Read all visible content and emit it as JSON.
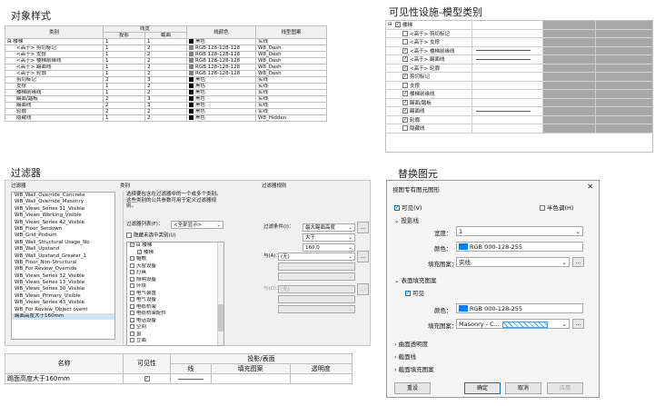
{
  "sections": {
    "object_style": "对象样式",
    "visibility": "可见性设施-模型类别",
    "filter": "过滤器",
    "replace": "替换图元"
  },
  "object_style_table": {
    "headers": {
      "category": "类别",
      "line_width": "线宽",
      "projection": "投影",
      "cut": "截面",
      "line_color": "线颜色",
      "line_pattern": "线型图案"
    },
    "rows": [
      {
        "name": "⊟ 楼梯",
        "proj": "1",
        "cut": "1",
        "color": "黑色",
        "swatch": "#000000",
        "pattern": "实线"
      },
      {
        "name": "<高于> 剪切标记",
        "proj": "1",
        "cut": "2",
        "color": "RGB 128-128-128",
        "swatch": "#808080",
        "pattern": "W8_Dash"
      },
      {
        "name": "<高于> 支撑",
        "proj": "1",
        "cut": "2",
        "color": "RGB 128-128-128",
        "swatch": "#808080",
        "pattern": "W8_Dash"
      },
      {
        "name": "<高于> 楼梯前缘线",
        "proj": "1",
        "cut": "2",
        "color": "RGB 128-128-128",
        "swatch": "#808080",
        "pattern": "W8_Dash"
      },
      {
        "name": "<高于> 踢面线",
        "proj": "1",
        "cut": "2",
        "color": "RGB 128-128-128",
        "swatch": "#808080",
        "pattern": "W8_Dash"
      },
      {
        "name": "<高于> 轮廓",
        "proj": "1",
        "cut": "2",
        "color": "RGB 128-128-128",
        "swatch": "#808080",
        "pattern": "W8_Dash"
      },
      {
        "name": "剪切标记",
        "proj": "2",
        "cut": "3",
        "color": "黑色",
        "swatch": "#000000",
        "pattern": "实线"
      },
      {
        "name": "支撑",
        "proj": "1",
        "cut": "2",
        "color": "黑色",
        "swatch": "#000000",
        "pattern": "实线"
      },
      {
        "name": "楼梯前缘线",
        "proj": "1",
        "cut": "2",
        "color": "黑色",
        "swatch": "#000000",
        "pattern": "实线"
      },
      {
        "name": "踢面/踏板",
        "proj": "2",
        "cut": "3",
        "color": "黑色",
        "swatch": "#000000",
        "pattern": "实线"
      },
      {
        "name": "踢面线",
        "proj": "2",
        "cut": "3",
        "color": "黑色",
        "swatch": "#000000",
        "pattern": "实线"
      },
      {
        "name": "轮廓",
        "proj": "2",
        "cut": "2",
        "color": "黑色",
        "swatch": "#000000",
        "pattern": "实线"
      },
      {
        "name": "隐藏线",
        "proj": "1",
        "cut": "2",
        "color": "黑色",
        "swatch": "#000000",
        "pattern": "W8_Hidden"
      }
    ]
  },
  "visibility_list": [
    {
      "label": "楼梯",
      "checked": true,
      "indent": 0,
      "expander": "⊟",
      "line": false
    },
    {
      "label": "<高于> 剪切标记",
      "checked": false,
      "indent": 1,
      "line": false
    },
    {
      "label": "<高于> 支撑",
      "checked": false,
      "indent": 1,
      "line": false
    },
    {
      "label": "<高于> 楼梯前缘线",
      "checked": true,
      "indent": 1,
      "line": true
    },
    {
      "label": "<高于> 踢面线",
      "checked": true,
      "indent": 1,
      "line": true
    },
    {
      "label": "<高于> 轮廓",
      "checked": true,
      "indent": 1,
      "line": false
    },
    {
      "label": "剪切标记",
      "checked": true,
      "indent": 1,
      "line": false
    },
    {
      "label": "支撑",
      "checked": false,
      "indent": 1,
      "line": false
    },
    {
      "label": "楼梯前缘线",
      "checked": true,
      "indent": 1,
      "line": false
    },
    {
      "label": "踢面/踏板",
      "checked": true,
      "indent": 1,
      "line": false
    },
    {
      "label": "踢面线",
      "checked": true,
      "indent": 1,
      "line": true
    },
    {
      "label": "轮廓",
      "checked": true,
      "indent": 1,
      "line": false
    },
    {
      "label": "隐藏线",
      "checked": false,
      "indent": 1,
      "line": false
    }
  ],
  "filter_dialog": {
    "filters_label": "过滤器",
    "category_label": "类别",
    "rules_label": "过滤器规则",
    "filters": [
      "WB_Wall_Override_Concrete",
      "WB_Wall_Override_Masonry",
      "WB_Views_Series 31_Visible",
      "WB_Views_Working_Visible",
      "WB_Views_Series 42_Visible",
      "WB_Floor_Setdown",
      "WB_Grid_Podium",
      "WB_Wall_Structural Usage_No",
      "WB_Wall_Upstand",
      "WB_Wall_Upstand_Greater_1",
      "WB_Floor_Non-Structural",
      "WB_For Review_Override",
      "WB_Views_Series 32_Visible",
      "WB_Views_Series 13_Visible",
      "WB_Views_Series 30_Visible",
      "WB_Views_Primary_Visible",
      "WB_Views_Series 43_Visible",
      "WB_For Review_Object overri",
      "踢面高度大于160mm"
    ],
    "category_desc": "选择要包含在过滤器中的一个或多个类别。这些类别的公共参数可用于定义过滤器规则。",
    "filter_list_label": "过滤器列表(F)：",
    "filter_list_value": "<全部显示>",
    "hide_unchecked": "隐藏未选中类别(U)",
    "categories": [
      {
        "label": "⊟ 楼梯",
        "checked": true,
        "indent": 0
      },
      {
        "label": "楼梯",
        "checked": true,
        "indent": 1
      },
      {
        "label": "帽檐",
        "checked": false,
        "indent": 0
      },
      {
        "label": "天窗设备",
        "checked": false,
        "indent": 0
      },
      {
        "label": "灯具",
        "checked": false,
        "indent": 0
      },
      {
        "label": "照明设备",
        "checked": false,
        "indent": 0
      },
      {
        "label": "环境",
        "checked": false,
        "indent": 0
      },
      {
        "label": "电气装置",
        "checked": false,
        "indent": 0
      },
      {
        "label": "电气设备",
        "checked": false,
        "indent": 0
      },
      {
        "label": "电缆桥架",
        "checked": false,
        "indent": 0
      },
      {
        "label": "电缆桥架配件",
        "checked": false,
        "indent": 0
      },
      {
        "label": "电话设备",
        "checked": false,
        "indent": 0
      },
      {
        "label": "空间",
        "checked": false,
        "indent": 0
      },
      {
        "label": "窗",
        "checked": false,
        "indent": 0
      },
      {
        "label": "立面",
        "checked": false,
        "indent": 0
      }
    ],
    "condition_label": "过滤条件(I)：",
    "condition_value": "最大踢面高度",
    "operator": "大于",
    "value": "160.0",
    "and_label": "与(A)：",
    "and_value": "(无)",
    "and2_label": "与(D)：",
    "and2_value": "(无)"
  },
  "bottom_table": {
    "name_header": "名称",
    "visible_header": "可见性",
    "proj_header": "投影/表面",
    "line_header": "线",
    "fill_header": "填充图案",
    "transparency_header": "透明度",
    "row_name": "踢面高度大于160mm"
  },
  "replace_dialog": {
    "title": "视图专有图元图形",
    "close": "✕",
    "visible": "可见(V)",
    "halftone": "半色调(H)",
    "projection_section": "投影线",
    "width_label": "宽度：",
    "width_value": "1",
    "color_label": "颜色：",
    "color_value": "RGB 000-128-255",
    "pattern_label": "填充图案：",
    "pattern_value": "实线",
    "surface_section": "表面填充图案",
    "surface_visible": "可见",
    "surface_color_value": "RGB 000-128-255",
    "surface_pattern_value": "Masonry - C...",
    "surface_transparency": "曲面透明度",
    "cut_lines": "截面线",
    "cut_pattern": "截面填充图案",
    "reset": "重设",
    "ok": "确定",
    "cancel": "取消",
    "apply": "应用",
    "accent": "#0080ff"
  }
}
